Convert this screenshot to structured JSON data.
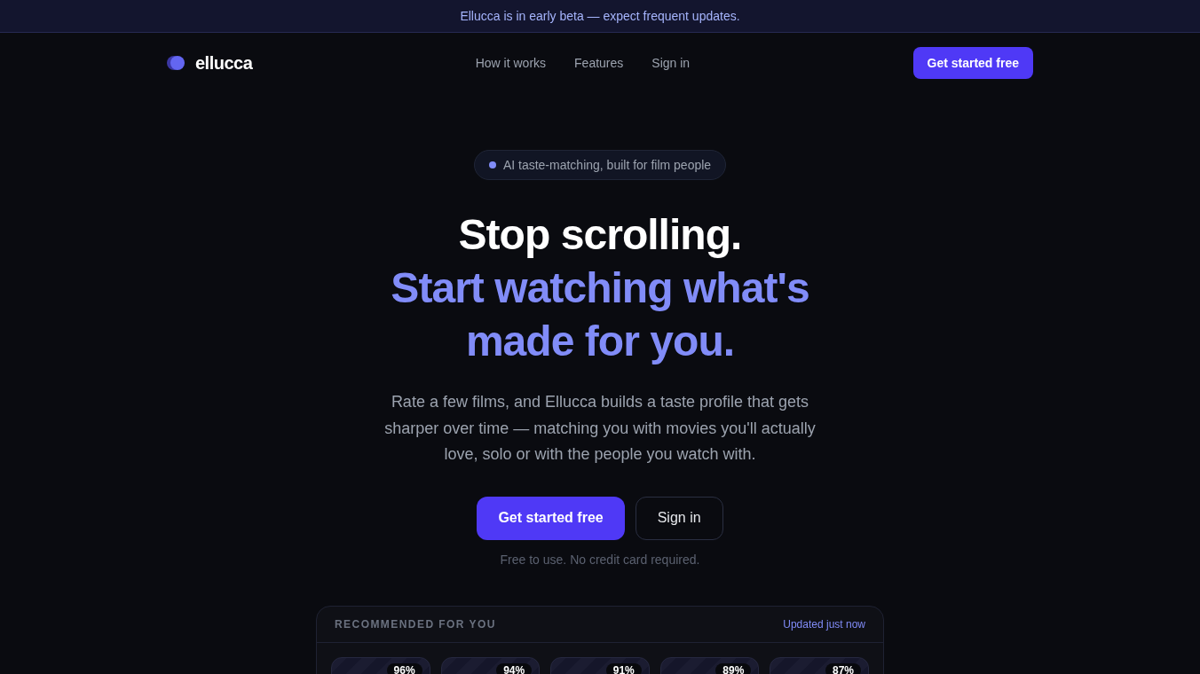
{
  "announcement": "Ellucca is in early beta — expect frequent updates.",
  "nav": {
    "brand": "ellucca",
    "links": [
      "How it works",
      "Features",
      "Sign in"
    ],
    "cta": "Get started free"
  },
  "hero": {
    "badge": "AI taste-matching, built for film people",
    "title": "Stop scrolling.",
    "title_highlight": "Start watching what's made for you.",
    "description": "Rate a few films, and Ellucca builds a taste profile that gets sharper over time — matching you with movies you'll actually love, solo or with the people you watch with.",
    "primary_button": "Get started free",
    "secondary_button": "Sign in",
    "note": "Free to use. No credit card required."
  },
  "recommendations": {
    "title": "RECOMMENDED FOR YOU",
    "status": "Updated just now",
    "items": [
      {
        "match": "96%"
      },
      {
        "match": "94%"
      },
      {
        "match": "91%"
      },
      {
        "match": "89%"
      },
      {
        "match": "87%"
      }
    ]
  }
}
